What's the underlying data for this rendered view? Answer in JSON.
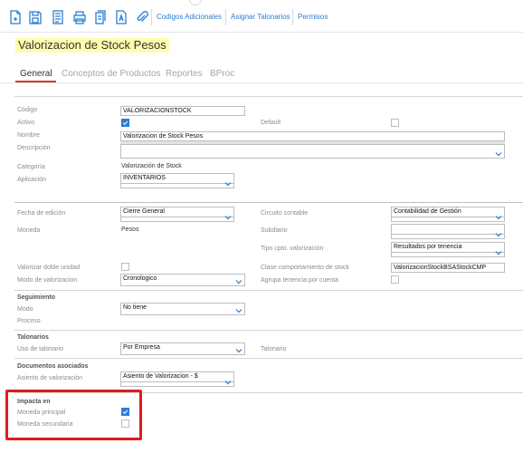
{
  "toolbar": {
    "links": [
      "Codigos Adicionales",
      "Asignar Talonarios",
      "Permisos"
    ]
  },
  "title": "Valorizacion de Stock Pesos",
  "tabs": [
    "General",
    "Conceptos de Productos",
    "Reportes",
    "BProc"
  ],
  "fields": {
    "codigo": {
      "label": "Código",
      "value": "VALORIZACIONSTOCK"
    },
    "activo": {
      "label": "Activo",
      "checked": true
    },
    "default": {
      "label": "Default",
      "checked": false
    },
    "nombre": {
      "label": "Nombre",
      "value": "Valorizacion de Stock Pesos"
    },
    "descripcion": {
      "label": "Descripción",
      "value": ""
    },
    "categoria": {
      "label": "Categoría",
      "value": "Valorización de Stock"
    },
    "aplicacion": {
      "label": "Aplicación",
      "value": "INVENTARIOS"
    },
    "fecha_edicion": {
      "label": "Fecha de edición",
      "value": "Cierre General"
    },
    "circuito_contable": {
      "label": "Circuito contable",
      "value": "Contabilidad de Gestión"
    },
    "moneda": {
      "label": "Moneda",
      "value": "Pesos"
    },
    "subdiario": {
      "label": "Subdiario",
      "value": ""
    },
    "tipo_cpto": {
      "label": "Tipo cpto. valorización",
      "value": "Resultados por tenencia"
    },
    "valorizar_doble": {
      "label": "Valorizar doble unidad",
      "checked": false
    },
    "clase_comportamiento": {
      "label": "Clase comportamiento de stock",
      "value": "ValorizacionStockBSAStockCMP"
    },
    "modo_valorizacion": {
      "label": "Modo de valorizacion",
      "value": "Cronologico"
    },
    "agrupa_tenencia": {
      "label": "Agrupa tenencia por cuenta",
      "checked": false
    }
  },
  "seguimiento": {
    "title": "Seguimiento",
    "modo_label": "Modo",
    "modo_value": "No tiene",
    "proceso_label": "Proceso"
  },
  "talonarios": {
    "title": "Talonarios",
    "uso_label": "Uso de talonario",
    "uso_value": "Por Empresa",
    "talonario_label": "Talonario"
  },
  "documentos": {
    "title": "Documentos asociados",
    "asiento_label": "Asiento de valorización",
    "asiento_value": "Asiento de Valorizacion - $"
  },
  "impacta": {
    "title": "Impacta en",
    "principal_label": "Moneda principal",
    "principal_checked": true,
    "secundaria_label": "Moneda secundaria",
    "secundaria_checked": false
  },
  "colors": {
    "accent": "#2b7ed2",
    "tab_active_underline": "#d9382f",
    "title_highlight": "#fdfdb0",
    "annotation_box": "#e01c1c"
  }
}
